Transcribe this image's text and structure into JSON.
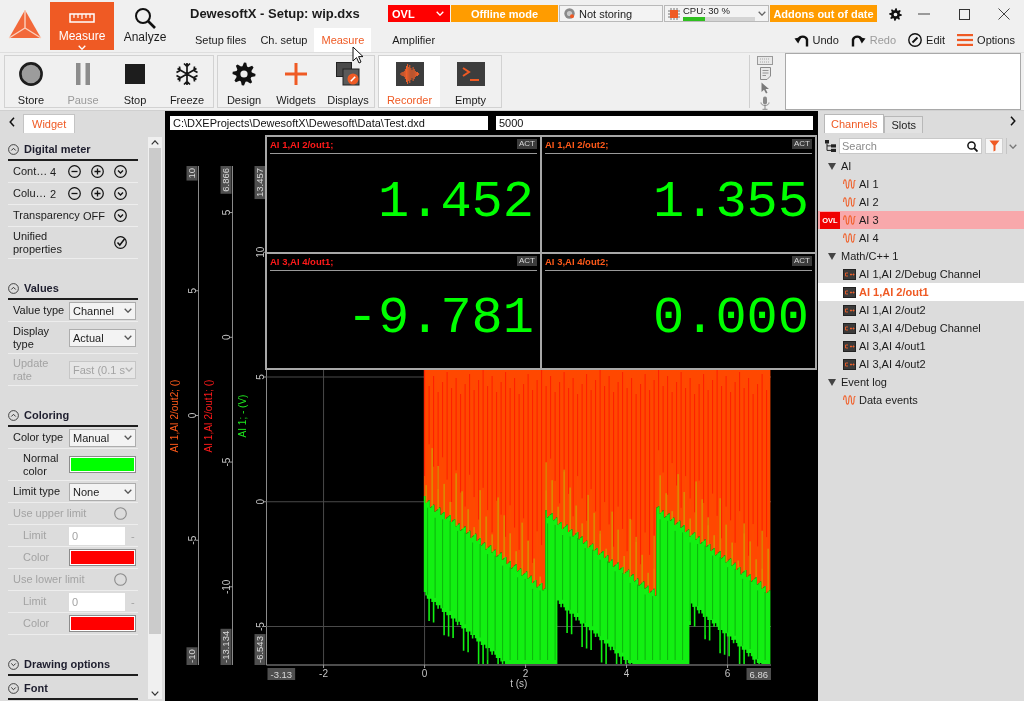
{
  "header": {
    "mode_buttons": [
      {
        "label": "Measure",
        "selected": true
      },
      {
        "label": "Analyze",
        "selected": false
      }
    ],
    "title": "DewesoftX - Setup: wip.dxs",
    "status_chips": [
      {
        "kind": "alarm",
        "label": "OVL"
      },
      {
        "kind": "mode",
        "label": "Offline mode"
      },
      {
        "kind": "storage",
        "label": "Not storing"
      },
      {
        "kind": "cpu",
        "label": "CPU: 30 %",
        "level": 0.3
      },
      {
        "kind": "notice",
        "label": "Addons out of date"
      }
    ],
    "tabs": [
      {
        "label": "Setup files",
        "selected": false
      },
      {
        "label": "Ch. setup",
        "selected": false
      },
      {
        "label": "Measure",
        "selected": true
      },
      {
        "label": "Amplifier",
        "selected": false
      }
    ],
    "actions": [
      {
        "label": "Undo",
        "disabled": false
      },
      {
        "label": "Redo",
        "disabled": true
      },
      {
        "label": "Edit",
        "disabled": false
      },
      {
        "label": "Options",
        "disabled": false
      }
    ]
  },
  "toolbar": {
    "groups": [
      {
        "buttons": [
          {
            "label": "Store",
            "disabled": false
          },
          {
            "label": "Pause",
            "disabled": true
          },
          {
            "label": "Stop",
            "disabled": false
          },
          {
            "label": "Freeze",
            "disabled": false
          }
        ]
      },
      {
        "buttons": [
          {
            "label": "Design"
          },
          {
            "label": "Widgets"
          },
          {
            "label": "Displays"
          }
        ]
      },
      {
        "buttons": [
          {
            "label": "Recorder",
            "selected": true
          },
          {
            "label": "Empty",
            "selected": false
          }
        ]
      }
    ]
  },
  "widget_panel": {
    "tabs": [
      {
        "label": "Widget",
        "selected": true
      }
    ],
    "sections": [
      {
        "title": "Digital meter",
        "expanded": true,
        "rows": [
          {
            "kind": "stepper",
            "label": "Cont…",
            "value": "4"
          },
          {
            "kind": "stepper",
            "label": "Colu…",
            "value": "2"
          },
          {
            "kind": "toggle",
            "label": "Transparency",
            "value": "OFF"
          },
          {
            "kind": "check",
            "label": "Unified properties",
            "checked": true
          }
        ]
      },
      {
        "title": "Values",
        "expanded": true,
        "rows": [
          {
            "kind": "select",
            "label": "Value type",
            "value": "Channel",
            "disabled": false
          },
          {
            "kind": "select",
            "label": "Display type",
            "value": "Actual",
            "disabled": false
          },
          {
            "kind": "select",
            "label": "Update rate",
            "value": "Fast (0.1 s",
            "disabled": true
          }
        ]
      },
      {
        "title": "Coloring",
        "expanded": true,
        "rows": [
          {
            "kind": "select",
            "label": "Color type",
            "value": "Manual",
            "disabled": false,
            "children": [
              {
                "kind": "color",
                "label": "Normal color",
                "color": "#00ff00",
                "disabled": false
              }
            ]
          },
          {
            "kind": "select",
            "label": "Limit type",
            "value": "None",
            "disabled": false
          },
          {
            "kind": "radio",
            "label": "Use upper limit",
            "checked": false,
            "disabled": true,
            "children": [
              {
                "kind": "input",
                "label": "Limit",
                "value": "0",
                "unit": "-",
                "disabled": true
              },
              {
                "kind": "color",
                "label": "Color",
                "color": "#ff0000",
                "disabled": true
              }
            ]
          },
          {
            "kind": "radio",
            "label": "Use lower limit",
            "checked": false,
            "disabled": true,
            "children": [
              {
                "kind": "input",
                "label": "Limit",
                "value": "0",
                "unit": "-",
                "disabled": true
              },
              {
                "kind": "color",
                "label": "Color",
                "color": "#ff0000",
                "disabled": true
              }
            ]
          }
        ]
      },
      {
        "title": "Drawing options",
        "expanded": false
      },
      {
        "title": "Font",
        "expanded": false
      }
    ]
  },
  "recorder": {
    "path_field": {
      "value": "C:\\DXEProjects\\DewesoftX\\Dewesoft\\Data\\Test.dxd"
    },
    "number_field": {
      "value": "5000"
    },
    "meters": [
      {
        "channel": "AI 1,AI 2/out1;",
        "color": "#ff1a1a",
        "badge": "ACT",
        "value": "1.452"
      },
      {
        "channel": "AI 1,AI 2/out2;",
        "color": "#ff5a1a",
        "badge": "ACT",
        "value": "1.355"
      },
      {
        "channel": "AI 3,AI 4/out1;",
        "color": "#ff1a1a",
        "badge": "ACT",
        "value": "-9.781"
      },
      {
        "channel": "AI 3,AI 4/out2;",
        "color": "#ff5a1a",
        "badge": "ACT",
        "value": "0.000"
      }
    ],
    "graph": {
      "y_axes": [
        {
          "label": "AI 1,AI 2/out2; ()",
          "color": "#ff5a1a",
          "max": "10",
          "min": "-10",
          "ticks": [
            "5",
            "0",
            "-5"
          ]
        },
        {
          "label": "AI 1,AI 2/out1; ()",
          "color": "#ff1a1a",
          "max": "6.866",
          "min": "-13.134",
          "ticks": [
            "5",
            "0",
            "-5",
            "-10"
          ]
        },
        {
          "label": "AI 1; - (V)",
          "color": "#1ee61e",
          "max": "13.457",
          "min": "-6.543",
          "ticks": [
            "10",
            "5",
            "0",
            "-5"
          ]
        }
      ],
      "x_axis": {
        "label": "t (s)",
        "min": "-3.13",
        "max": "6.86",
        "ticks": [
          "-2",
          "0",
          "2",
          "4",
          "6"
        ]
      }
    }
  },
  "channel_panel": {
    "tabs": [
      {
        "label": "Channels",
        "selected": true
      },
      {
        "label": "Slots",
        "selected": false
      }
    ],
    "search": {
      "placeholder": "Search"
    },
    "tree": [
      {
        "label": "AI",
        "expanded": true,
        "selected": false,
        "children": [
          {
            "label": "AI 1",
            "kind": "signal",
            "selected": false,
            "overload": false
          },
          {
            "label": "AI 2",
            "kind": "signal",
            "selected": false,
            "overload": false
          },
          {
            "label": "AI 3",
            "kind": "signal",
            "selected": false,
            "overload": true,
            "badge": "OVL"
          },
          {
            "label": "AI 4",
            "kind": "signal",
            "selected": false,
            "overload": false
          }
        ]
      },
      {
        "label": "Math/C++ 1",
        "expanded": true,
        "selected": false,
        "children": [
          {
            "label": "AI 1,AI 2/Debug Channel",
            "kind": "math",
            "selected": false,
            "overload": false
          },
          {
            "label": "AI 1,AI 2/out1",
            "kind": "math",
            "selected": true,
            "overload": false
          },
          {
            "label": "AI 1,AI 2/out2",
            "kind": "math",
            "selected": false,
            "overload": false
          },
          {
            "label": "AI 3,AI 4/Debug Channel",
            "kind": "math",
            "selected": false,
            "overload": false
          },
          {
            "label": "AI 3,AI 4/out1",
            "kind": "math",
            "selected": false,
            "overload": false
          },
          {
            "label": "AI 3,AI 4/out2",
            "kind": "math",
            "selected": false,
            "overload": false
          }
        ]
      },
      {
        "label": "Event log",
        "expanded": true,
        "selected": false,
        "children": [
          {
            "label": "Data events",
            "kind": "signal",
            "selected": false,
            "overload": false
          }
        ]
      }
    ]
  }
}
